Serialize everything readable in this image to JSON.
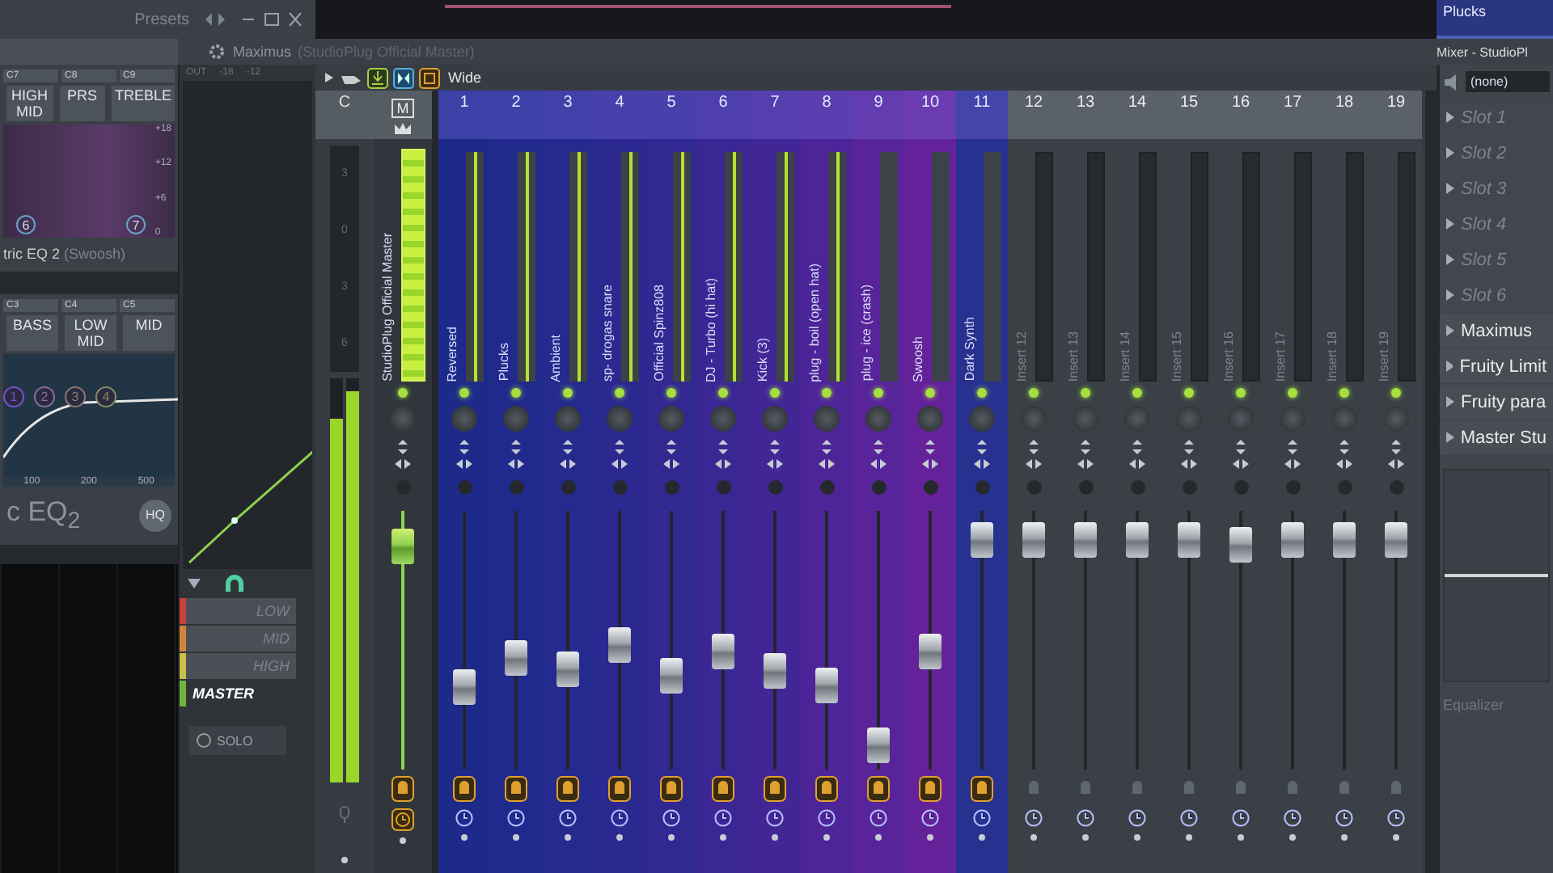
{
  "top_bar": {
    "title": "Presets"
  },
  "clip": {
    "label": "Plucks"
  },
  "eq_top": {
    "bands": [
      "C7",
      "C8",
      "C9"
    ],
    "ranges": [
      "HIGH MID",
      "PRS",
      "TREBLE"
    ],
    "db_labels": [
      "+18",
      "+12",
      "+6",
      "0"
    ],
    "nodes": [
      "6",
      "7"
    ],
    "title": "tric EQ 2",
    "subtitle": "(Swoosh)"
  },
  "eq_bottom": {
    "bands": [
      "C3",
      "C4",
      "C5"
    ],
    "ranges": [
      "BASS",
      "LOW MID",
      "MID"
    ],
    "nodes": [
      {
        "label": "1",
        "color": "#7a4fd0"
      },
      {
        "label": "2",
        "color": "#8a6aa0"
      },
      {
        "label": "3",
        "color": "#8a7a70"
      },
      {
        "label": "4",
        "color": "#8a8a60"
      }
    ],
    "freq_labels": [
      "100",
      "200",
      "500"
    ],
    "title": "c EQ$_{2}$",
    "hq": "HQ"
  },
  "maximus": {
    "title": "Maximus",
    "subtitle": "(StudioPlug Official Master)",
    "scale": [
      "-18",
      "-12"
    ],
    "out_label": "OUT",
    "bands": [
      {
        "label": "LOW",
        "color": "#c8413f",
        "selected": false
      },
      {
        "label": "MID",
        "color": "#d0853f",
        "selected": false
      },
      {
        "label": "HIGH",
        "color": "#c8c04a",
        "selected": false
      },
      {
        "label": "MASTER",
        "color": "#6fb43f",
        "selected": true
      }
    ],
    "solo": "SOLO"
  },
  "mixer": {
    "toolbar_label": "Wide",
    "current": {
      "label": "C",
      "scale": [
        "3",
        "0",
        "3",
        "6"
      ],
      "meters": [
        {
          "level": 0.9
        },
        {
          "level": 0.97
        }
      ]
    },
    "master": {
      "label": "M",
      "name": "StudioPlug Official Master",
      "level": 0.92,
      "routed": true
    },
    "channels": [
      {
        "number": "1",
        "name": "Reversed",
        "color": "#1d2a8a",
        "signal": true,
        "level": 0.29,
        "routed": true
      },
      {
        "number": "2",
        "name": "Plucks",
        "color": "#202a8c",
        "signal": true,
        "level": 0.42,
        "routed": true
      },
      {
        "number": "3",
        "name": "Ambient",
        "color": "#252a8e",
        "signal": true,
        "level": 0.37,
        "routed": true
      },
      {
        "number": "4",
        "name": "sp- drogas snare",
        "color": "#2b2990",
        "signal": true,
        "level": 0.48,
        "routed": true
      },
      {
        "number": "5",
        "name": "Official Spinz808",
        "color": "#322892",
        "signal": true,
        "level": 0.34,
        "routed": true
      },
      {
        "number": "6",
        "name": "DJ - Turbo (hi hat)",
        "color": "#3a2794",
        "signal": true,
        "level": 0.45,
        "routed": true
      },
      {
        "number": "7",
        "name": "Kick (3)",
        "color": "#432696",
        "signal": true,
        "level": 0.36,
        "routed": true
      },
      {
        "number": "8",
        "name": "plug - boil (open hat)",
        "color": "#4d2598",
        "signal": true,
        "level": 0.3,
        "routed": true
      },
      {
        "number": "9",
        "name": "plug - ice (crash)",
        "color": "#582499",
        "signal": false,
        "level": 0.03,
        "routed": true
      },
      {
        "number": "10",
        "name": "Swoosh",
        "color": "#64229a",
        "signal": false,
        "level": 0.45,
        "routed": true
      },
      {
        "number": "11",
        "name": "Dark Synth",
        "color": "#27318f",
        "signal": false,
        "level": 0.95,
        "routed": true
      },
      {
        "number": "12",
        "name": "Insert 12",
        "signal": false,
        "level": 0.95,
        "routed": false
      },
      {
        "number": "13",
        "name": "Insert 13",
        "signal": false,
        "level": 0.95,
        "routed": false
      },
      {
        "number": "14",
        "name": "Insert 14",
        "signal": false,
        "level": 0.95,
        "routed": false
      },
      {
        "number": "15",
        "name": "Insert 15",
        "signal": false,
        "level": 0.95,
        "routed": false
      },
      {
        "number": "16",
        "name": "Insert 16",
        "signal": false,
        "level": 0.93,
        "routed": false
      },
      {
        "number": "17",
        "name": "Insert 17",
        "signal": false,
        "level": 0.95,
        "routed": false
      },
      {
        "number": "18",
        "name": "Insert 18",
        "signal": false,
        "level": 0.95,
        "routed": false
      },
      {
        "number": "19",
        "name": "Insert 19",
        "signal": false,
        "level": 0.95,
        "routed": false
      }
    ]
  },
  "panel": {
    "title": "Mixer - StudioPl",
    "input": "(none)",
    "slots": [
      {
        "label": "Slot 1",
        "empty": true
      },
      {
        "label": "Slot 2",
        "empty": true
      },
      {
        "label": "Slot 3",
        "empty": true
      },
      {
        "label": "Slot 4",
        "empty": true
      },
      {
        "label": "Slot 5",
        "empty": true
      },
      {
        "label": "Slot 6",
        "empty": true
      },
      {
        "label": "Maximus",
        "empty": false
      },
      {
        "label": "Fruity Limit",
        "empty": false
      },
      {
        "label": "Fruity para",
        "empty": false
      },
      {
        "label": "Master Stu",
        "empty": false
      }
    ],
    "eq_label": "Equalizer"
  }
}
